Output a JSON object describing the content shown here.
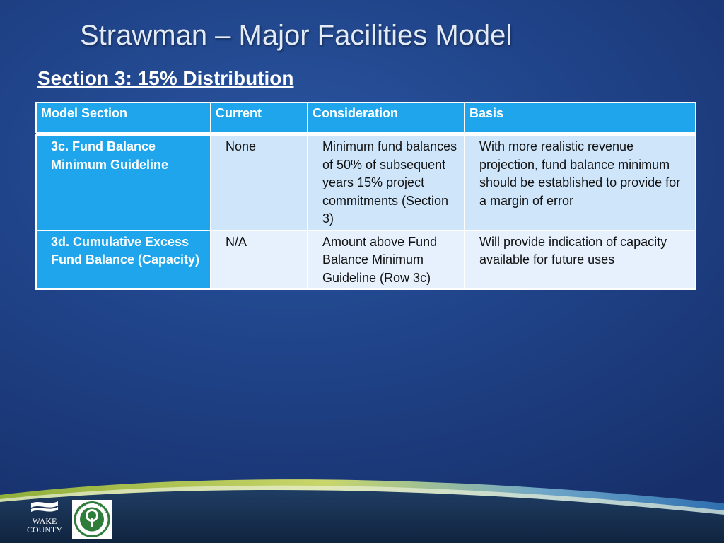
{
  "slide": {
    "title": "Strawman – Major Facilities Model",
    "subtitle": "Section 3:  15% Distribution"
  },
  "table": {
    "headers": [
      "Model Section",
      "Current",
      "Consideration",
      "Basis"
    ],
    "rows": [
      {
        "section": "3c.  Fund Balance Minimum Guideline",
        "current": "None",
        "consideration": "Minimum fund balances of 50% of subsequent years 15% project commitments (Section 3)",
        "basis": "With more realistic revenue projection, fund balance minimum should be established to provide for a margin of error"
      },
      {
        "section": "3d. Cumulative Excess Fund Balance (Capacity)",
        "current": "N/A",
        "consideration": "Amount above Fund Balance Minimum Guideline (Row 3c)",
        "basis": "Will provide indication of capacity available for future uses"
      }
    ]
  },
  "logos": {
    "wake_county": "WAKE COUNTY",
    "seal_icon": "county-seal-icon"
  },
  "colors": {
    "header_blue": "#1fa5ec",
    "row_light": "#cfe5fa",
    "row_lighter": "#e6f1fd"
  }
}
